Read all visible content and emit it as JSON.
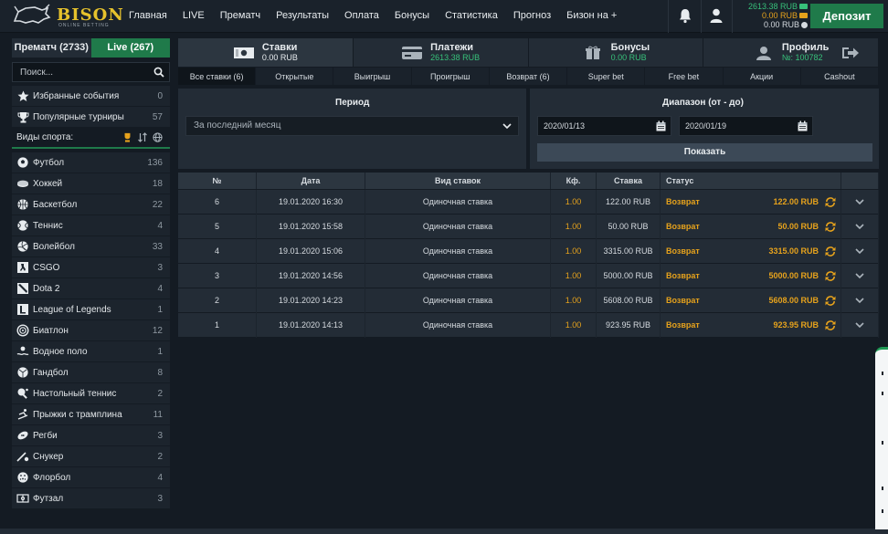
{
  "header": {
    "logo_text": "BISON",
    "logo_sub": "ONLINE BETTING",
    "nav": [
      "Главная",
      "LIVE",
      "Прематч",
      "Результаты",
      "Оплата",
      "Бонусы",
      "Статистика",
      "Прогноз",
      "Бизон на +"
    ],
    "balance_main": "2613.38 RUB",
    "balance_bonus": "0.00 RUB",
    "balance_other": "0.00 RUB",
    "deposit_label": "Депозит",
    "icons": [
      "bell-icon",
      "user-icon"
    ],
    "colors": {
      "accent_green": "#1f7a4a",
      "gold": "#e6c22c",
      "orange": "#e6a21c"
    }
  },
  "sidebar": {
    "tab_prematch": "Прематч (2733)",
    "tab_live": "Live (267)",
    "search_placeholder": "Поиск...",
    "favorites": {
      "label": "Избранные события",
      "count": "0"
    },
    "popular": {
      "label": "Популярные турниры",
      "count": "57"
    },
    "sports_title": "Виды спорта:",
    "sports": [
      {
        "label": "Футбол",
        "count": "136",
        "icon": "football-icon"
      },
      {
        "label": "Хоккей",
        "count": "18",
        "icon": "hockey-icon"
      },
      {
        "label": "Баскетбол",
        "count": "22",
        "icon": "basketball-icon"
      },
      {
        "label": "Теннис",
        "count": "4",
        "icon": "tennis-icon"
      },
      {
        "label": "Волейбол",
        "count": "33",
        "icon": "volleyball-icon"
      },
      {
        "label": "CSGO",
        "count": "3",
        "icon": "csgo-icon"
      },
      {
        "label": "Dota 2",
        "count": "4",
        "icon": "dota-icon"
      },
      {
        "label": "League of Legends",
        "count": "1",
        "icon": "lol-icon"
      },
      {
        "label": "Биатлон",
        "count": "12",
        "icon": "biathlon-icon"
      },
      {
        "label": "Водное поло",
        "count": "1",
        "icon": "water-polo-icon"
      },
      {
        "label": "Гандбол",
        "count": "8",
        "icon": "handball-icon"
      },
      {
        "label": "Настольный теннис",
        "count": "2",
        "icon": "table-tennis-icon"
      },
      {
        "label": "Прыжки с трамплина",
        "count": "11",
        "icon": "ski-jump-icon"
      },
      {
        "label": "Регби",
        "count": "3",
        "icon": "rugby-icon"
      },
      {
        "label": "Снукер",
        "count": "2",
        "icon": "snooker-icon"
      },
      {
        "label": "Флорбол",
        "count": "4",
        "icon": "floorball-icon"
      },
      {
        "label": "Футзал",
        "count": "3",
        "icon": "futsal-icon"
      }
    ]
  },
  "account_tabs": [
    {
      "name": "Ставки",
      "value": "0.00 RUB",
      "icon": "cash-icon"
    },
    {
      "name": "Платежи",
      "value": "2613.38 RUB",
      "icon": "card-icon"
    },
    {
      "name": "Бонусы",
      "value": "0.00 RUB",
      "icon": "gift-icon"
    },
    {
      "name": "Профиль",
      "value": "№: 100782",
      "icon": "profile-icon"
    }
  ],
  "subtabs": [
    "Все ставки (6)",
    "Открытые",
    "Выигрыш",
    "Проигрыш",
    "Возврат (6)",
    "Super bet",
    "Free bet",
    "Акции",
    "Cashout"
  ],
  "filters": {
    "period_title": "Период",
    "period_value": "За последний месяц",
    "range_title": "Диапазон (от - до)",
    "date_from": "2020/01/13",
    "date_to": "2020/01/19",
    "show_label": "Показать"
  },
  "table": {
    "headers": [
      "№",
      "Дата",
      "Вид ставок",
      "Кф.",
      "Ставка",
      "Статус"
    ],
    "rows": [
      {
        "no": "6",
        "date": "19.01.2020 16:30",
        "type": "Одиночная ставка",
        "kf": "1.00",
        "stake": "122.00 RUB",
        "status": "Возврат",
        "amount": "122.00 RUB"
      },
      {
        "no": "5",
        "date": "19.01.2020 15:58",
        "type": "Одиночная ставка",
        "kf": "1.00",
        "stake": "50.00 RUB",
        "status": "Возврат",
        "amount": "50.00 RUB"
      },
      {
        "no": "4",
        "date": "19.01.2020 15:06",
        "type": "Одиночная ставка",
        "kf": "1.00",
        "stake": "3315.00 RUB",
        "status": "Возврат",
        "amount": "3315.00 RUB"
      },
      {
        "no": "3",
        "date": "19.01.2020 14:56",
        "type": "Одиночная ставка",
        "kf": "1.00",
        "stake": "5000.00 RUB",
        "status": "Возврат",
        "amount": "5000.00 RUB"
      },
      {
        "no": "2",
        "date": "19.01.2020 14:23",
        "type": "Одиночная ставка",
        "kf": "1.00",
        "stake": "5608.00 RUB",
        "status": "Возврат",
        "amount": "5608.00 RUB"
      },
      {
        "no": "1",
        "date": "19.01.2020 14:13",
        "type": "Одиночная ставка",
        "kf": "1.00",
        "stake": "923.95 RUB",
        "status": "Возврат",
        "amount": "923.95 RUB"
      }
    ]
  }
}
